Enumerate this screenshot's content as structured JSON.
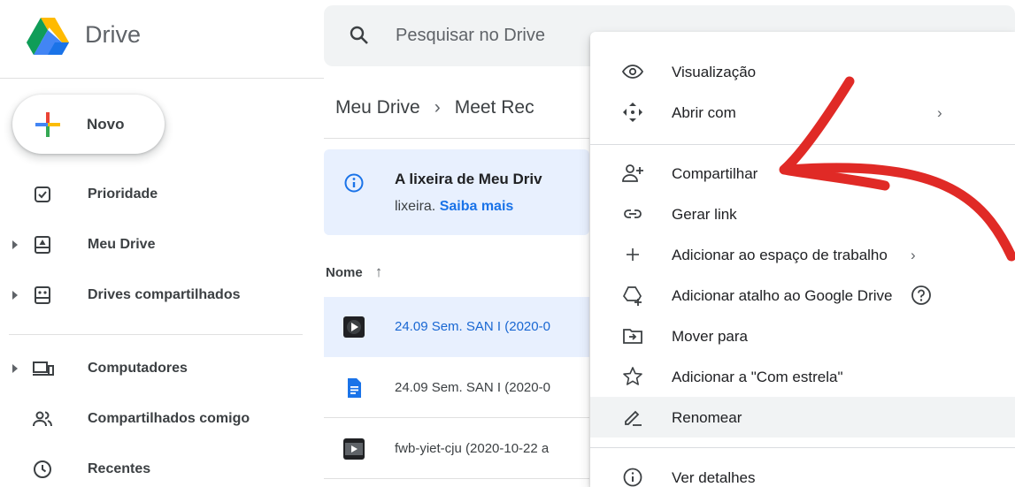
{
  "header": {
    "app_name": "Drive",
    "search_placeholder": "Pesquisar no Drive"
  },
  "sidebar": {
    "new_label": "Novo",
    "items": [
      {
        "label": "Prioridade",
        "icon": "priority-check-icon"
      },
      {
        "label": "Meu Drive",
        "icon": "my-drive-icon"
      },
      {
        "label": "Drives compartilhados",
        "icon": "shared-drives-icon"
      },
      {
        "label": "Computadores",
        "icon": "computers-icon"
      },
      {
        "label": "Compartilhados comigo",
        "icon": "shared-with-me-icon"
      },
      {
        "label": "Recentes",
        "icon": "clock-icon"
      }
    ]
  },
  "main": {
    "breadcrumb": {
      "root": "Meu Drive",
      "current": "Meet Rec"
    },
    "banner": {
      "title": "A lixeira de Meu Driv",
      "text": "lixeira.",
      "link": "Saiba mais"
    },
    "column_name": "Nome",
    "files": [
      {
        "name": "24.09 Sem. SAN I (2020-0",
        "icon": "video-file-icon",
        "selected": true
      },
      {
        "name": "24.09 Sem. SAN I (2020-0",
        "icon": "doc-file-icon",
        "selected": false
      },
      {
        "name": "fwb-yiet-cju (2020-10-22 a",
        "icon": "video-file-icon",
        "selected": false
      }
    ]
  },
  "context_menu": {
    "items": [
      {
        "label": "Visualização",
        "icon": "eye-icon"
      },
      {
        "label": "Abrir com",
        "icon": "move-arrows-icon",
        "submenu": true
      },
      {
        "label": "Compartilhar",
        "icon": "add-person-icon"
      },
      {
        "label": "Gerar link",
        "icon": "link-icon"
      },
      {
        "label": "Adicionar ao espaço de trabalho",
        "icon": "plus-icon",
        "submenu": true
      },
      {
        "label": "Adicionar atalho ao Google Drive",
        "icon": "add-shortcut-icon",
        "help": true
      },
      {
        "label": "Mover para",
        "icon": "move-to-folder-icon"
      },
      {
        "label": "Adicionar a \"Com estrela\"",
        "icon": "star-icon"
      },
      {
        "label": "Renomear",
        "icon": "pencil-icon",
        "highlighted": true
      },
      {
        "label": "Ver detalhes",
        "icon": "info-icon"
      }
    ]
  },
  "colors": {
    "accent_blue": "#1a73e8",
    "selected_bg": "#e8f0fe",
    "annotation_red": "#e02a26"
  }
}
